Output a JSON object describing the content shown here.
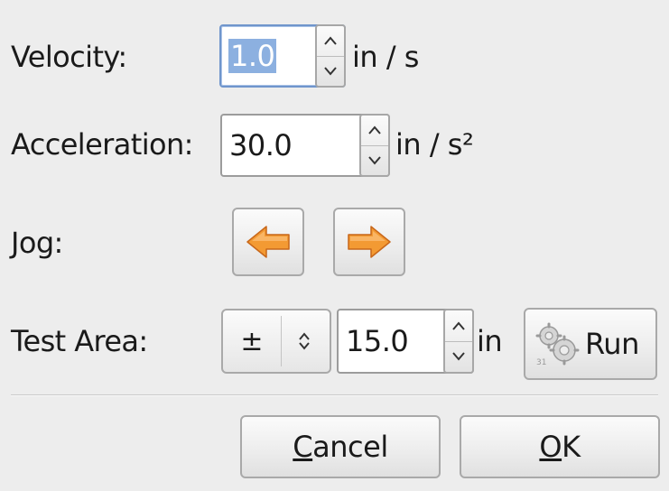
{
  "velocity": {
    "label": "Velocity:",
    "value": "1.0",
    "unit": "in / s"
  },
  "acceleration": {
    "label": "Acceleration:",
    "value": "30.0",
    "unit": "in / s²"
  },
  "jog": {
    "label": "Jog:"
  },
  "test_area": {
    "label": "Test Area:",
    "direction_option": "±",
    "value": "15.0",
    "unit": "in",
    "run_label": "Run"
  },
  "buttons": {
    "cancel_mnemonic": "C",
    "cancel_rest": "ancel",
    "ok_mnemonic": "O",
    "ok_rest": "K"
  },
  "colors": {
    "background": "#ededed",
    "jog_arrow": "#f39a33",
    "focus_border": "#6f95cc",
    "selection": "#8cb0e0"
  }
}
